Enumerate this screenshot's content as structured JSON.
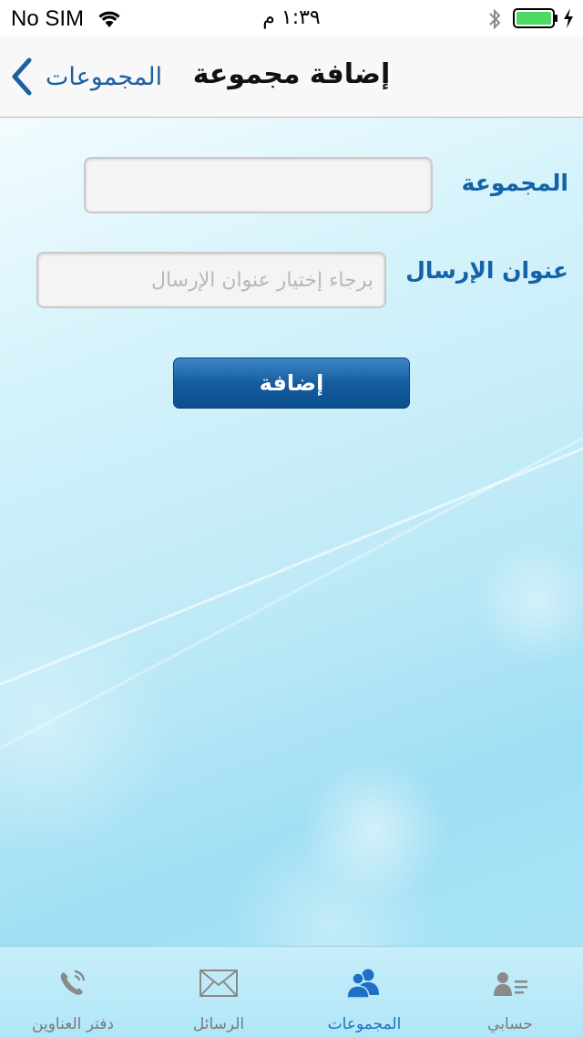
{
  "status_bar": {
    "carrier": "No SIM",
    "time": "١:٣٩ م",
    "wifi_icon": "wifi-icon",
    "bluetooth_icon": "bluetooth-icon",
    "battery_icon": "battery-icon",
    "charging_icon": "charging-bolt-icon",
    "battery_color": "#4cd964"
  },
  "nav": {
    "back_label": "المجموعات",
    "title": "إضافة مجموعة",
    "accent_color": "#1d5fa3"
  },
  "form": {
    "group_label": "المجموعة",
    "group_value": "",
    "group_placeholder": "",
    "address_label": "عنوان الإرسال",
    "address_value": "",
    "address_placeholder": "برجاء إختيار عنوان الإرسال",
    "submit_label": "إضافة"
  },
  "tab_bar": {
    "active_color": "#1f6fc4",
    "items": [
      {
        "label": "دفتر العناوين",
        "icon": "phone-icon",
        "active": false
      },
      {
        "label": "الرسائل",
        "icon": "envelope-icon",
        "active": false
      },
      {
        "label": "المجموعات",
        "icon": "group-icon",
        "active": true
      },
      {
        "label": "حسابي",
        "icon": "account-icon",
        "active": false
      }
    ]
  }
}
